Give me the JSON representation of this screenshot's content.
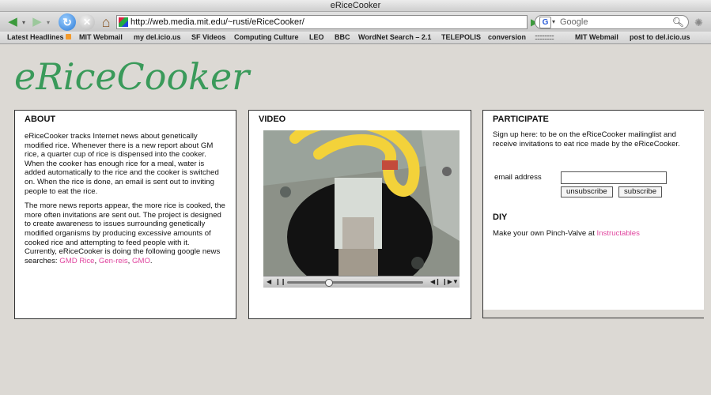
{
  "window": {
    "title": "eRiceCooker"
  },
  "toolbar": {
    "url": "http://web.media.mit.edu/~rusti/eRiceCooker/",
    "search_placeholder": "Google",
    "search_engine": "G"
  },
  "bookmarks": [
    "Latest Headlines",
    "MIT Webmail",
    "my del.icio.us",
    "SF Videos",
    "Computing Culture",
    "LEO",
    "BBC",
    "WordNet Search – 2.1",
    "TELEPOLIS",
    "conversion",
    "::::::::::::::::",
    "MIT Webmail",
    "post to del.icio.us"
  ],
  "page": {
    "logo": "eRiceCooker",
    "about": {
      "title": "ABOUT",
      "p1": "eRiceCooker tracks Internet news about genetically modified rice. Whenever there is a new report about GM rice, a quarter cup of rice is dispensed into the cooker. When the cooker has enough rice for a meal, water is added automatically to the rice and the cooker is  switched on. When the rice is done, an email is sent out to inviting people to eat the rice.",
      "p2": "The more news reports appear, the more rice is cooked, the more often invitations are sent out.  The project is designed to create awareness  to issues surrounding genetically modified organisms by producing excessive amounts of  cooked rice and attempting to feed people with it.",
      "p3": "Currently, eRiceCooker is doing the following google news searches:",
      "searches": [
        "GMD Rice",
        "Gen-reis",
        "GMO"
      ]
    },
    "video": {
      "title": "VIDEO"
    },
    "participate": {
      "title": "PARTICIPATE",
      "intro": "Sign up here: to be on the eRiceCooker mailinglist and receive invitations to eat rice made by the eRiceCooker.",
      "email_label": "email address",
      "email_value": "",
      "unsubscribe_label": "unsubscribe",
      "subscribe_label": "subscribe"
    },
    "diy": {
      "title": "DIY",
      "text": "Make your own Pinch-Valve at",
      "link": "Instructables"
    }
  },
  "colors": {
    "logo": "#3a9a5a",
    "link": "#e0449e",
    "page_background": "#dcd9d4"
  }
}
